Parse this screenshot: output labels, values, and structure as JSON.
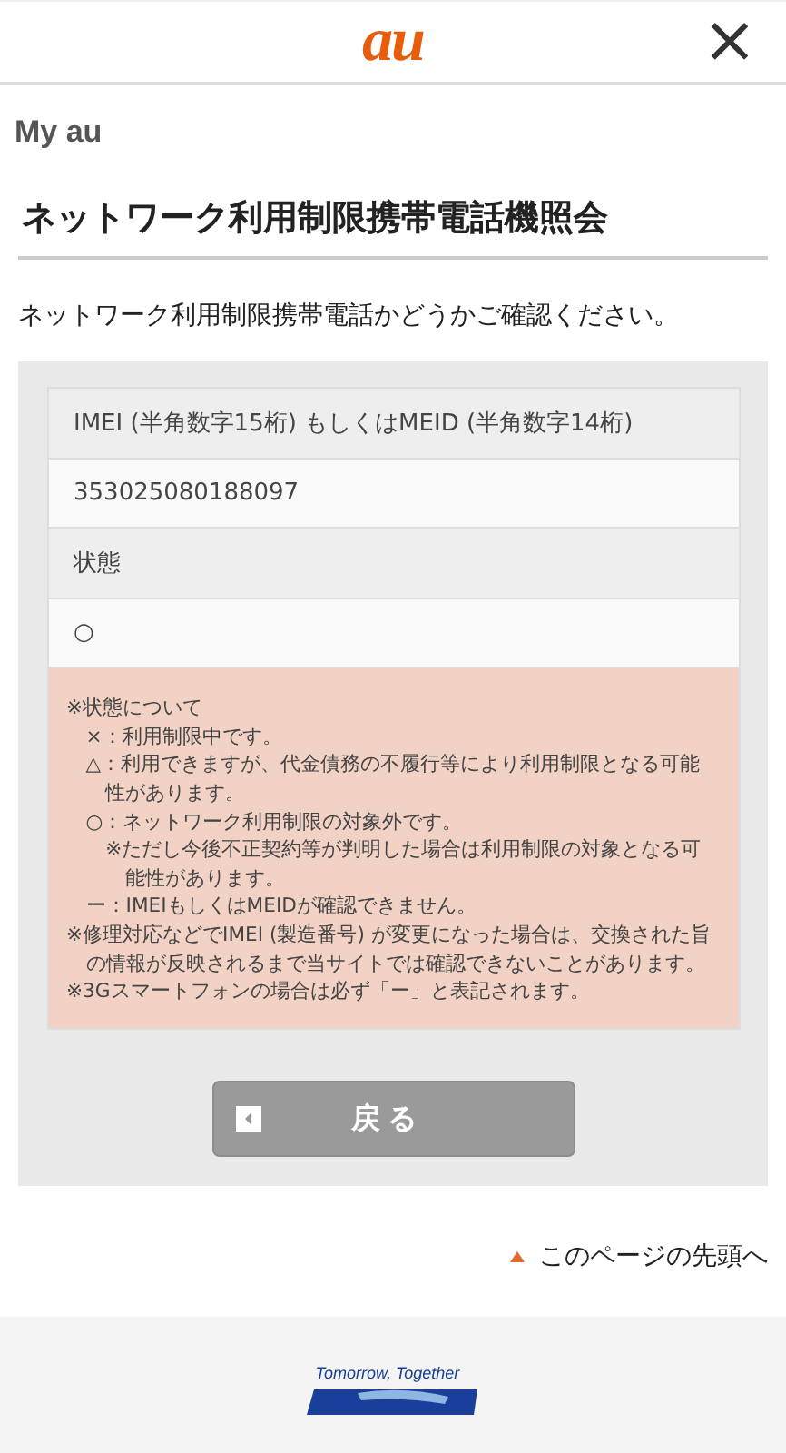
{
  "header": {
    "logo": "au",
    "close": "×"
  },
  "brand": "My au",
  "title": "ネットワーク利用制限携帯電話機照会",
  "description": "ネットワーク利用制限携帯電話かどうかご確認ください。",
  "fields": [
    {
      "label": "IMEI (半角数字15桁) もしくはMEID (半角数字14桁)",
      "value": "353025080188097"
    },
    {
      "label": "状態",
      "value": "○"
    }
  ],
  "notes": [
    {
      "text": "※状態について",
      "children": [
        {
          "text": "×：利用制限中です。"
        },
        {
          "text": "△：利用できますが、代金債務の不履行等により利用制限となる可能性があります。"
        },
        {
          "text": "○：ネットワーク利用制限の対象外です。",
          "children": [
            {
              "text": "※ただし今後不正契約等が判明した場合は利用制限の対象となる可能性があります。"
            }
          ]
        },
        {
          "text": "ー：IMEIもしくはMEIDが確認できません。"
        }
      ]
    },
    {
      "text": "※修理対応などでIMEI (製造番号) が変更になった場合は、交換された旨の情報が反映されるまで当サイトでは確認できないことがあります。"
    },
    {
      "text": "※3Gスマートフォンの場合は必ず「ー」と表記されます。"
    }
  ],
  "back_button": "戻る",
  "page_top_link": "このページの先頭へ",
  "footer": {
    "tagline": "Tomorrow, Together"
  }
}
